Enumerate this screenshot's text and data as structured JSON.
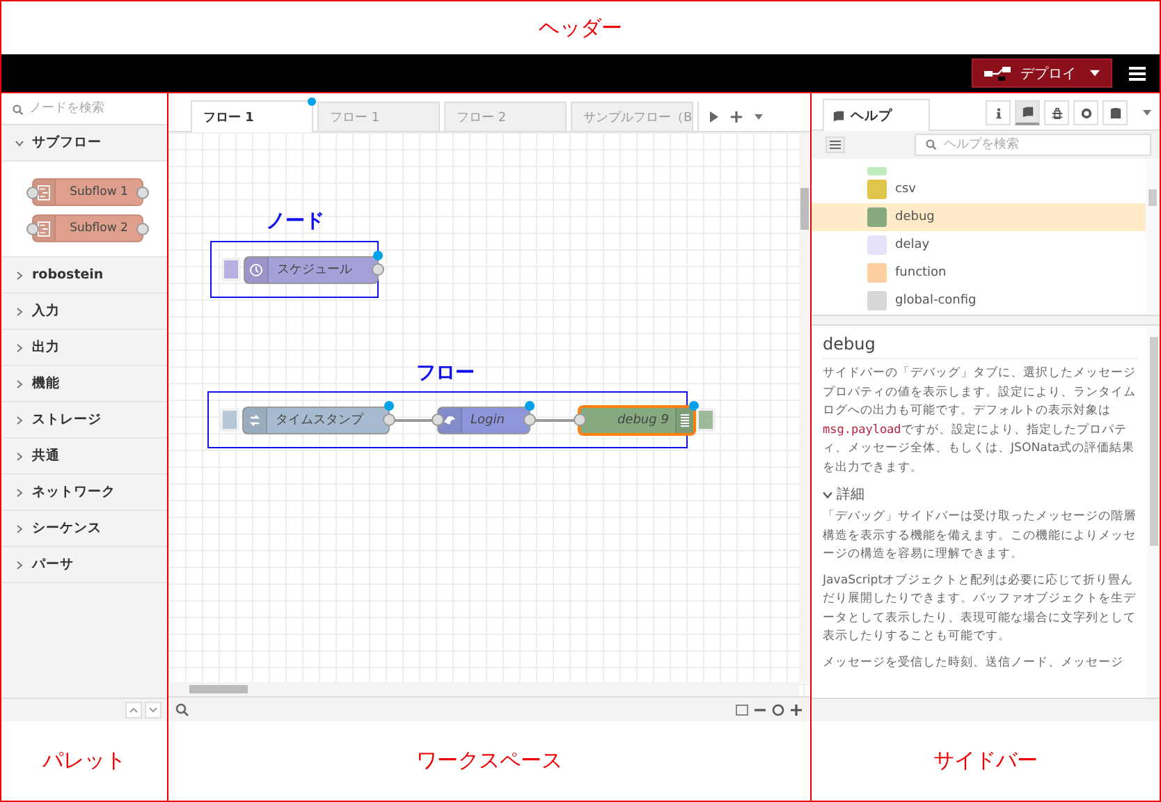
{
  "annotations": {
    "header": "ヘッダー",
    "palette": "パレット",
    "workspace": "ワークスペース",
    "sidebar": "サイドバー",
    "node": "ノード",
    "flow": "フロー"
  },
  "header": {
    "deploy_label": "デプロイ"
  },
  "palette": {
    "search_placeholder": "ノードを検索",
    "categories": [
      {
        "label": "サブフロー",
        "expanded": true,
        "nodes": [
          {
            "label": "Subflow 1",
            "color": "#dea08c"
          },
          {
            "label": "Subflow 2",
            "color": "#dea08c"
          }
        ]
      },
      {
        "label": "robostein",
        "expanded": false
      },
      {
        "label": "入力",
        "expanded": false
      },
      {
        "label": "出力",
        "expanded": false
      },
      {
        "label": "機能",
        "expanded": false
      },
      {
        "label": "ストレージ",
        "expanded": false
      },
      {
        "label": "共通",
        "expanded": false
      },
      {
        "label": "ネットワーク",
        "expanded": false
      },
      {
        "label": "シーケンス",
        "expanded": false
      },
      {
        "label": "パーサ",
        "expanded": false
      }
    ]
  },
  "workspace": {
    "tabs": [
      {
        "label": "フロー 1",
        "selected": true,
        "changed": true
      },
      {
        "label": "フロー 1",
        "selected": false,
        "changed": false
      },
      {
        "label": "フロー 2",
        "selected": false,
        "changed": false
      },
      {
        "label": "サンプルフロー（B",
        "selected": false,
        "changed": false
      }
    ],
    "single_node": {
      "label": "スケジュール",
      "kind": "inject",
      "color": "#a6a0d8",
      "italic": false,
      "changed": true,
      "selected": false
    },
    "flow_nodes": [
      {
        "label": "タイムスタンプ",
        "kind": "inject",
        "color": "#a6bbcf",
        "italic": false,
        "changed": true,
        "selected": false
      },
      {
        "label": "Login",
        "kind": "function",
        "color": "#8d96db",
        "italic": true,
        "changed": true,
        "selected": false
      },
      {
        "label": "debug 9",
        "kind": "debug",
        "color": "#87a980",
        "italic": true,
        "changed": true,
        "selected": true
      }
    ]
  },
  "sidebar": {
    "tab_label": "ヘルプ",
    "tab_buttons": [
      {
        "kind": "info",
        "selected": false
      },
      {
        "kind": "book",
        "selected": true
      },
      {
        "kind": "bug",
        "selected": false
      },
      {
        "kind": "gear",
        "selected": false
      },
      {
        "kind": "database",
        "selected": false
      }
    ],
    "search_placeholder": "ヘルプを検索",
    "help_nodes": [
      {
        "label": "csv",
        "color": "#dfc54a",
        "selected": false
      },
      {
        "label": "debug",
        "color": "#87a980",
        "selected": true
      },
      {
        "label": "delay",
        "color": "#e6e0f8",
        "selected": false
      },
      {
        "label": "function",
        "color": "#fdd0a2",
        "selected": false
      },
      {
        "label": "global-config",
        "color": "#d8d8d8",
        "selected": false
      }
    ],
    "help_title": "debug",
    "intro": [
      {
        "kind": "text",
        "text": "サイドバーの「デバッグ」タブに、選択したメッセージプロパティの値を表示します。設定により、ランタイムログへの出力も可能です。デフォルトの表示対象は"
      },
      {
        "kind": "code",
        "text": "msg.payload"
      },
      {
        "kind": "text",
        "text": "ですが、設定により、指定したプロパティ、メッセージ全体、もしくは、JSONata式の評価結果を出力できます。"
      }
    ],
    "details_heading": "詳細",
    "details_expanded": true,
    "details": [
      "「デバッグ」サイドバーは受け取ったメッセージの階層構造を表示する機能を備えます。この機能によりメッセージの構造を容易に理解できます。",
      "JavaScriptオブジェクトと配列は必要に応じて折り畳んだり展開したりできます。バッファオブジェクトを生データとして表示したり、表現可能な場合に文字列として表示したりすることも可能です。",
      "メッセージを受信した時刻、送信ノード、メッセージ"
    ]
  }
}
